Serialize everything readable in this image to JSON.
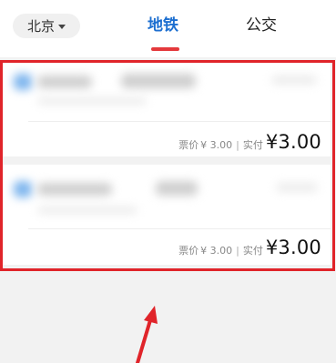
{
  "header": {
    "city": "北京",
    "tabs": [
      {
        "label": "地铁",
        "active": true
      },
      {
        "label": "公交",
        "active": false
      }
    ]
  },
  "results": [
    {
      "fare_label": "票价",
      "fare_value": "¥ 3.00",
      "paid_label": "实付",
      "paid_value": "¥3.00"
    },
    {
      "fare_label": "票价",
      "fare_value": "¥ 3.00",
      "paid_label": "实付",
      "paid_value": "¥3.00"
    }
  ],
  "colors": {
    "accent": "#1d6fd0",
    "indicator": "#e4393c",
    "highlight": "#e0242a"
  }
}
